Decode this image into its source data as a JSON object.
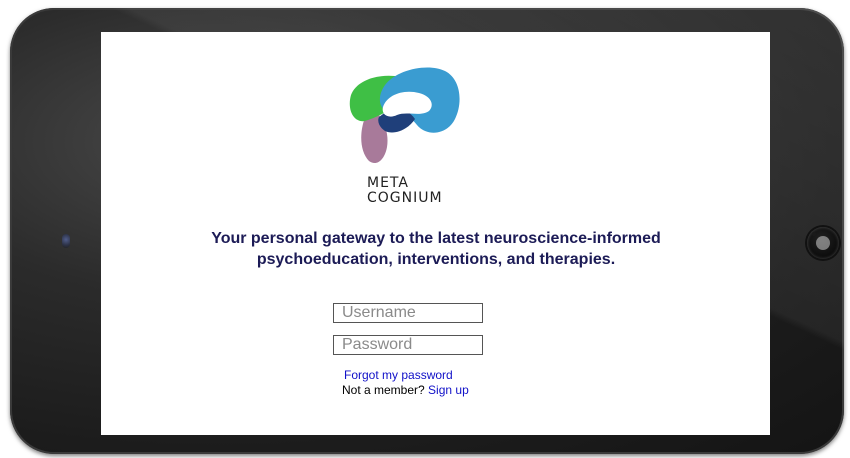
{
  "brand": {
    "wordmark_line1": "META",
    "wordmark_line2": "COGNIUM",
    "logo_icon": "meta-cognium-logo",
    "colors": {
      "green": "#3fbf45",
      "blue": "#3a9cd1",
      "navy": "#1f3f7a",
      "mauve": "#a87a9a"
    }
  },
  "tagline": {
    "line1": "Your personal gateway to the latest neuroscience-informed",
    "line2": "psychoeducation, interventions, and therapies.",
    "color": "#1c1b56"
  },
  "login": {
    "username_placeholder": "Username",
    "password_placeholder": "Password",
    "forgot_link": "Forgot my password",
    "not_member_text": "Not a member?",
    "signup_link": "Sign up",
    "link_color": "#1010c8"
  },
  "device": {
    "camera_icon": "camera-icon",
    "home_button_icon": "home-button-icon"
  }
}
